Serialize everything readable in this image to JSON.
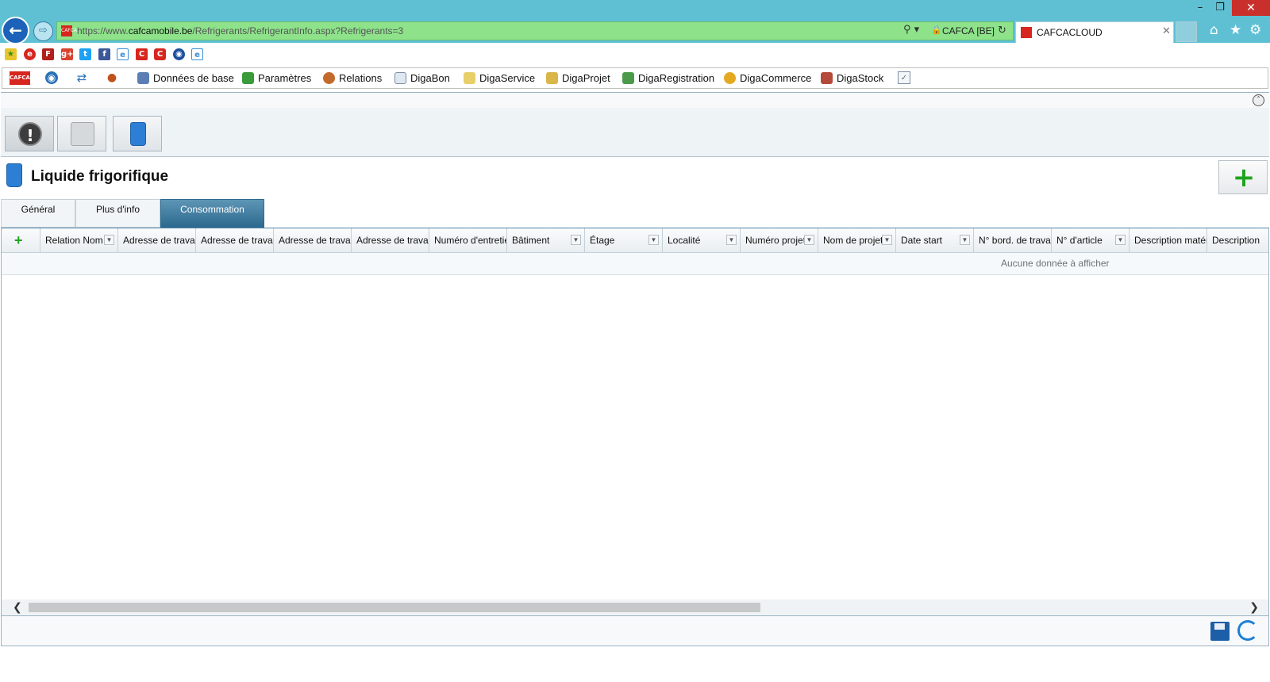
{
  "browser": {
    "window_controls": {
      "minimize": "–",
      "restore": "❐",
      "close": "✕"
    },
    "url_prefix": "https://www.",
    "url_domain": "cafcamobile.be",
    "url_path": "/Refrigerants/RefrigerantInfo.aspx?Refrigerants=3",
    "cert_label": "CAFCA [BE]",
    "tab_title": "CAFCACLOUD",
    "colors": {
      "titlebar": "#5fc0d4",
      "addressbar": "#8de28a",
      "back_button": "#1c62b9"
    }
  },
  "appbar": {
    "menu": [
      {
        "label": "Données de base",
        "icon": "database-icon"
      },
      {
        "label": "Paramètres",
        "icon": "settings-cubes-icon"
      },
      {
        "label": "Relations",
        "icon": "people-icon"
      },
      {
        "label": "DigaBon",
        "icon": "document-icon"
      },
      {
        "label": "DigaService",
        "icon": "service-folder-icon"
      },
      {
        "label": "DigaProjet",
        "icon": "project-folder-icon"
      },
      {
        "label": "DigaRegistration",
        "icon": "registration-icon"
      },
      {
        "label": "DigaCommerce",
        "icon": "coin-icon"
      },
      {
        "label": "DigaStock",
        "icon": "stock-box-icon"
      }
    ]
  },
  "page": {
    "title": "Liquide frigorifique",
    "tabs": [
      "Général",
      "Plus d'info",
      "Consommation"
    ],
    "active_tab": "Consommation"
  },
  "grid": {
    "columns": [
      "Relation Nom",
      "Adresse de travail",
      "Adresse de travail",
      "Adresse de travail",
      "Adresse de travail",
      "Numéro d'entretien",
      "Bâtiment",
      "Étage",
      "Localité",
      "Numéro projet",
      "Nom de projet",
      "Date start",
      "N° bord. de travail",
      "N° d'article",
      "Description matériel",
      "Description"
    ],
    "empty_text": "Aucune donnée à afficher"
  }
}
